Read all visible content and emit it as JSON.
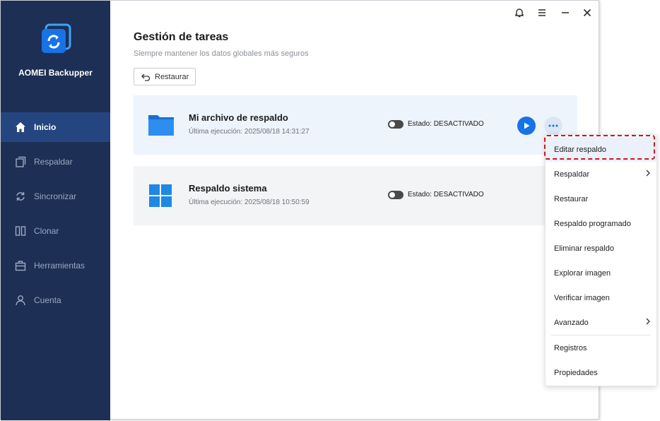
{
  "app": {
    "name": "AOMEI Backupper"
  },
  "sidebar": {
    "items": [
      {
        "label": "Inicio",
        "icon": "home-icon",
        "active": true
      },
      {
        "label": "Respaldar",
        "icon": "backup-icon"
      },
      {
        "label": "Sincronizar",
        "icon": "sync-icon"
      },
      {
        "label": "Clonar",
        "icon": "clone-icon"
      },
      {
        "label": "Herramientas",
        "icon": "tools-icon"
      },
      {
        "label": "Cuenta",
        "icon": "user-icon"
      }
    ]
  },
  "titlebar": {
    "icons": [
      "bell-icon",
      "hamburger-icon",
      "minimize-icon",
      "close-icon"
    ]
  },
  "main": {
    "title": "Gestión de tareas",
    "subtitle": "Siempre mantener los datos globales más seguros",
    "restore_label": "Restaurar"
  },
  "tasks": [
    {
      "title": "Mi archivo de respaldo",
      "last_run": "Última ejecución: 2025/08/18 14:31:27",
      "status": "Estado: DESACTIVADO",
      "icon": "folder-icon"
    },
    {
      "title": "Respaldo sistema",
      "last_run": "Última ejecución: 2025/08/18 10:50:59",
      "status": "Estado: DESACTIVADO",
      "icon": "windows-icon"
    }
  ],
  "context_menu": {
    "items": [
      {
        "label": "Editar respaldo",
        "highlighted": true
      },
      {
        "label": "Respaldar",
        "submenu": true
      },
      {
        "label": "Restaurar"
      },
      {
        "label": "Respaldo programado"
      },
      {
        "label": "Eliminar respaldo"
      },
      {
        "label": "Explorar imagen"
      },
      {
        "label": "Verificar imagen"
      },
      {
        "label": "Avanzado",
        "submenu": true
      },
      {
        "label": "Registros"
      },
      {
        "label": "Propiedades"
      }
    ]
  },
  "colors": {
    "sidebar_bg": "#1d2f54",
    "sidebar_active": "#24457f",
    "accent": "#1773e6",
    "highlight_border": "#d0141a"
  }
}
